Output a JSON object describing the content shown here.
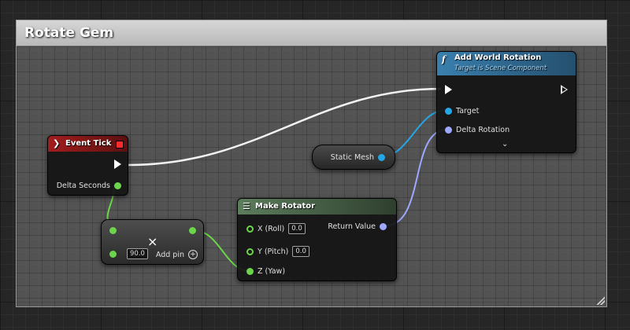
{
  "comment": {
    "title": "Rotate Gem"
  },
  "event_tick": {
    "title": "Event Tick",
    "pins": {
      "delta_seconds": "Delta Seconds"
    }
  },
  "add_world_rotation": {
    "title": "Add World Rotation",
    "subtitle": "Target is Scene Component",
    "pins": {
      "target": "Target",
      "delta_rotation": "Delta Rotation"
    }
  },
  "static_mesh": {
    "label": "Static Mesh"
  },
  "multiply": {
    "value": "90.0",
    "add_pin": "Add pin",
    "operator_symbol": "×"
  },
  "make_rotator": {
    "title": "Make Rotator",
    "pins": {
      "x": {
        "label": "X (Roll)",
        "value": "0.0"
      },
      "y": {
        "label": "Y (Pitch)",
        "value": "0.0"
      },
      "z": {
        "label": "Z (Yaw)"
      },
      "return": "Return Value"
    }
  },
  "colors": {
    "float_pin": "#6cd64a",
    "object_pin": "#24a7e6",
    "rotator_pin": "#9fa8ff",
    "event_header": "#9a1b1b",
    "function_header": "#2f6d98",
    "make_header": "#4a6b4a"
  },
  "icons": {
    "event": "event-diamond-icon",
    "function": "function-icon",
    "expand": "chevron-down-icon",
    "add_pin": "add-circle-icon"
  }
}
